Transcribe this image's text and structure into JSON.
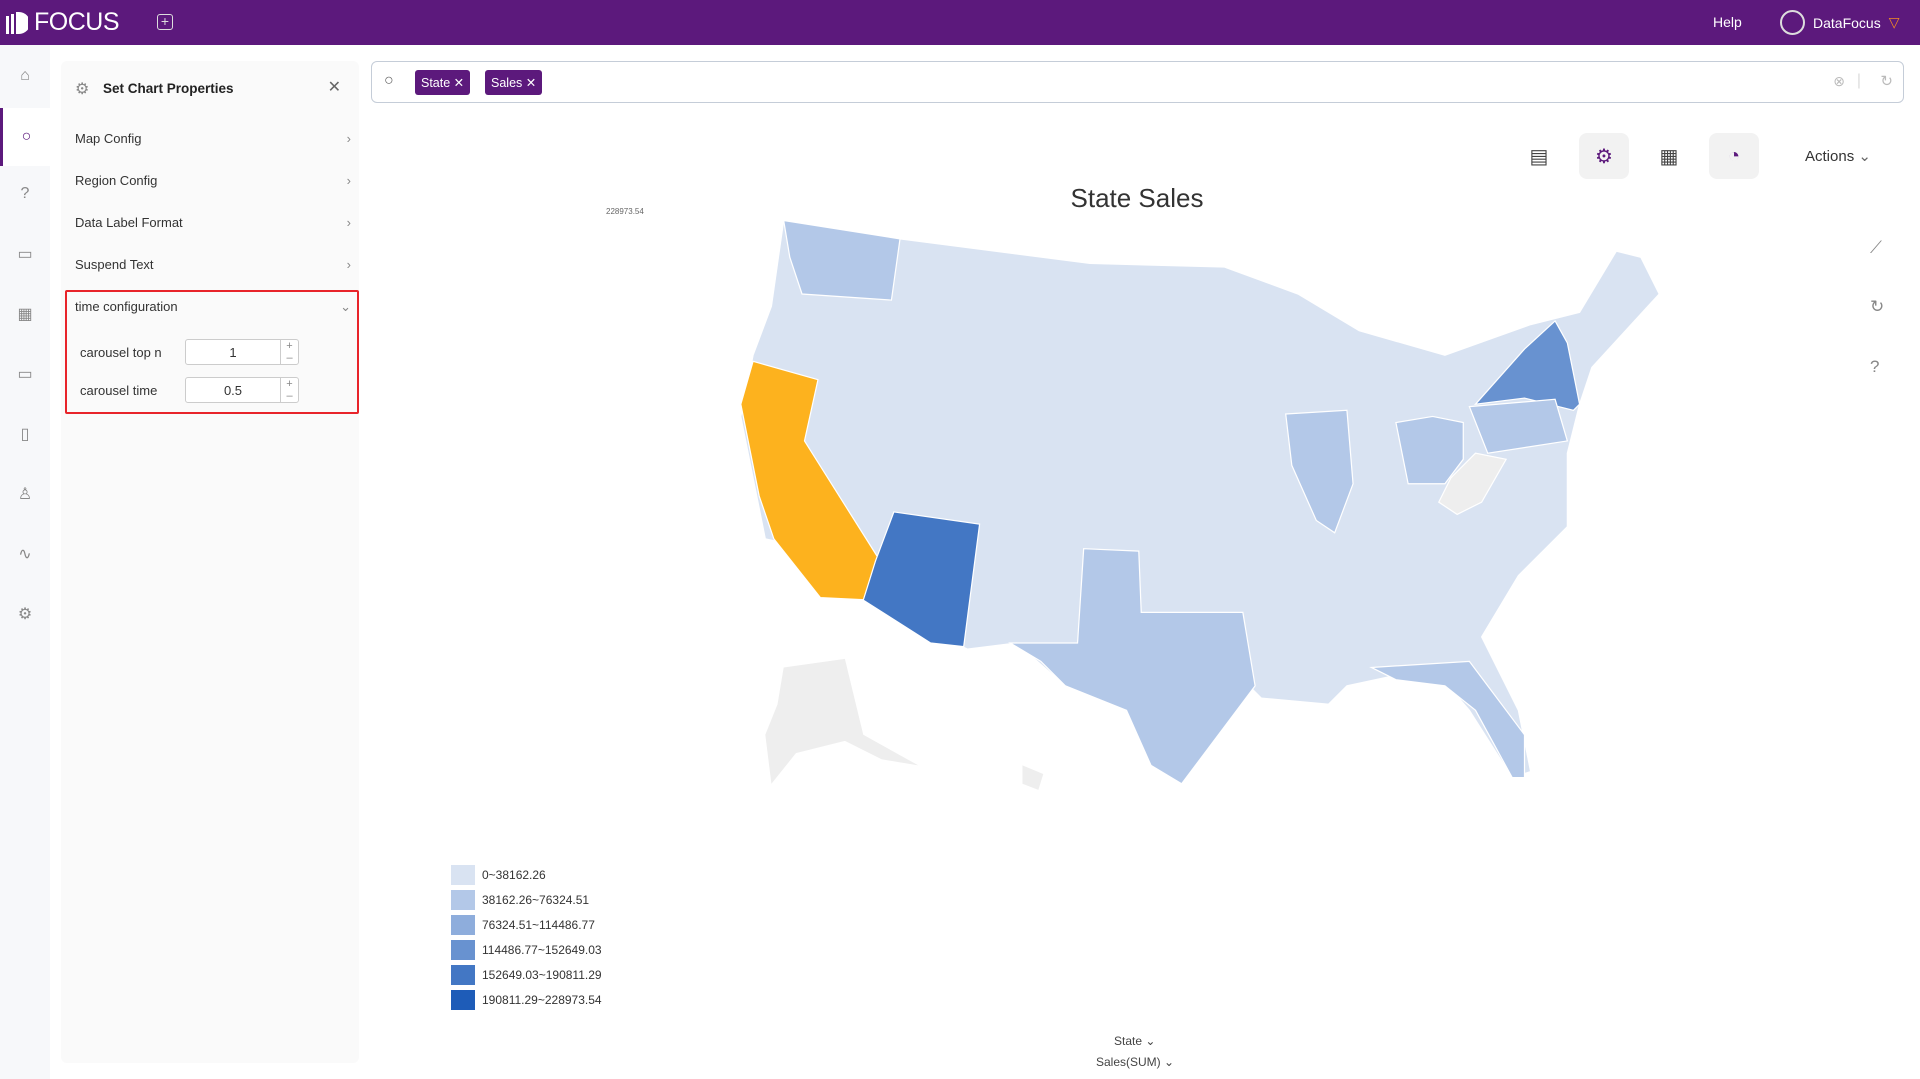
{
  "app": {
    "logo": "FOCUS",
    "help": "Help",
    "user": "DataFocus",
    "brand_color": "#5c197c"
  },
  "nav": [
    {
      "icon": "home-icon"
    },
    {
      "icon": "search-icon",
      "active": true
    },
    {
      "icon": "help-icon"
    },
    {
      "icon": "presentation-icon"
    },
    {
      "icon": "table-icon"
    },
    {
      "icon": "folder-icon"
    },
    {
      "icon": "clipboard-icon"
    },
    {
      "icon": "user-icon"
    },
    {
      "icon": "activity-icon"
    },
    {
      "icon": "settings-icon"
    }
  ],
  "panel": {
    "title": "Set Chart Properties",
    "items": [
      {
        "label": "Map Config"
      },
      {
        "label": "Region Config"
      },
      {
        "label": "Data Label Format"
      },
      {
        "label": "Suspend Text"
      }
    ],
    "time_config": {
      "label": "time configuration",
      "carousel_top_n_label": "carousel top n",
      "carousel_top_n": "1",
      "carousel_time_label": "carousel time",
      "carousel_time": "0.5"
    }
  },
  "search": {
    "chips": [
      "State",
      "Sales"
    ]
  },
  "toolbar": {
    "actions": "Actions"
  },
  "chart_data": {
    "type": "map",
    "title": "State Sales",
    "max_label": "228973.54",
    "legend": [
      {
        "label": "0~38162.26",
        "color": "#d9e3f2"
      },
      {
        "label": "38162.26~76324.51",
        "color": "#b3c8e8"
      },
      {
        "label": "76324.51~114486.77",
        "color": "#8eaddc"
      },
      {
        "label": "114486.77~152649.03",
        "color": "#6892d0"
      },
      {
        "label": "152649.03~190811.29",
        "color": "#4377c4"
      },
      {
        "label": "190811.29~228973.54",
        "color": "#1e5cb8"
      }
    ],
    "highlight_color": "#fdb21e",
    "highlighted_state": "California",
    "states": {
      "California": "highlighted",
      "Arizona": 5,
      "New York": 4,
      "Texas": 2,
      "Florida": 2,
      "Washington": 2,
      "Illinois": 2,
      "Ohio": 2,
      "Pennsylvania": 2,
      "West Virginia": "no data",
      "Alaska": "no data"
    },
    "x_field": "State",
    "y_field": "Sales(SUM)"
  }
}
